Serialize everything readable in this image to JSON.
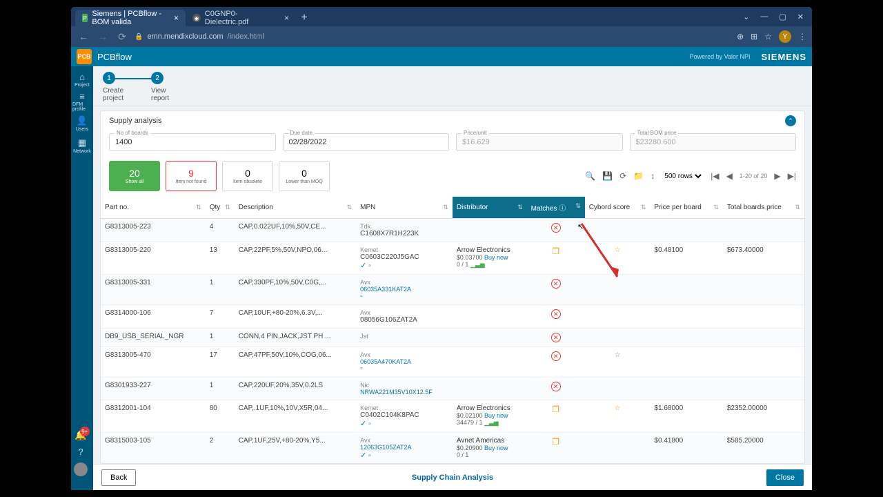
{
  "browser": {
    "tabs": [
      {
        "title": "Siemens | PCBflow - BOM valida",
        "active": true
      },
      {
        "title": "C0GNP0-Dielectric.pdf",
        "active": false
      }
    ],
    "url_host": "emn.mendixcloud.com",
    "url_path": "/index.html",
    "avatar_letter": "Y"
  },
  "app": {
    "title": "PCBflow",
    "powered_by": "Powered by Valor NPI",
    "brand": "SIEMENS",
    "rail": [
      {
        "icon": "⌂",
        "label": "Project"
      },
      {
        "icon": "≡",
        "label": "DFM profile"
      },
      {
        "icon": "👤",
        "label": "Users"
      },
      {
        "icon": "▦",
        "label": "Network"
      }
    ]
  },
  "stepper": {
    "s1_num": "1",
    "s1_l1": "Create",
    "s1_l2": "project",
    "s2_num": "2",
    "s2_l1": "View",
    "s2_l2": "report"
  },
  "panel": {
    "title": "Supply analysis",
    "no_boards_label": "No of boards",
    "no_boards": "1400",
    "due_date_label": "Due date",
    "due_date": "02/28/2022",
    "price_unit_label": "Price/unit",
    "price_unit": "$16.629",
    "total_bom_label": "Total BOM price",
    "total_bom": "$23280.600"
  },
  "cards": {
    "c1_num": "20",
    "c1_lbl": "Show all",
    "c2_num": "9",
    "c2_lbl": "Item not found",
    "c3_num": "0",
    "c3_lbl": "Item obsolete",
    "c4_num": "0",
    "c4_lbl": "Lower than MOQ"
  },
  "toolbar": {
    "rows": "500 rows",
    "page": "1-20 of 20"
  },
  "headers": {
    "partno": "Part no.",
    "qty": "Qty",
    "desc": "Description",
    "mpn": "MPN",
    "dist": "Distributor",
    "matches": "Matches",
    "cybord": "Cybord score",
    "ppb": "Price per board",
    "tbp": "Total boards price"
  },
  "rows": [
    {
      "partno": "G8313005-223",
      "qty": "4",
      "desc": "CAP,0.022UF,10%,50V,CE...",
      "mpn_mfr": "Tdk",
      "mpn_pn": "C1608X7R1H223K",
      "mpn_link": false,
      "chk": false,
      "dist": "",
      "match": "x",
      "star": "",
      "ppb": "",
      "tbp": ""
    },
    {
      "partno": "G8313005-220",
      "qty": "13",
      "desc": "CAP,22PF,5%,50V,NPO,06...",
      "mpn_mfr": "Kemet",
      "mpn_pn": "C0603C220J5GAC",
      "mpn_link": false,
      "chk": true,
      "dist": {
        "name": "Arrow Electronics",
        "price": "$0.03700",
        "buy": "Buy now",
        "qty": "0 / 1",
        "bars": true
      },
      "match": "stack",
      "star": "o",
      "ppb": "$0.48100",
      "tbp": "$673.40000"
    },
    {
      "partno": "G8313005-331",
      "qty": "1",
      "desc": "CAP,330PF,10%,50V,C0G,...",
      "mpn_mfr": "Avx",
      "mpn_pn": "06035A331KAT2A",
      "mpn_link": true,
      "chk": false,
      "box": true,
      "dist": "",
      "match": "x",
      "star": "",
      "ppb": "",
      "tbp": ""
    },
    {
      "partno": "G8314000-106",
      "qty": "7",
      "desc": "CAP,10UF,+80-20%,6.3V,...",
      "mpn_mfr": "Avx",
      "mpn_pn": "08056G106ZAT2A",
      "mpn_link": false,
      "chk": false,
      "dist": "",
      "match": "x",
      "star": "",
      "ppb": "",
      "tbp": ""
    },
    {
      "partno": "DB9_USB_SERIAL_NGR",
      "qty": "1",
      "desc": "CONN,4 PIN,JACK,JST PH ...",
      "mpn_mfr": "Jst",
      "mpn_pn": "",
      "mpn_link": false,
      "chk": false,
      "dist": "",
      "match": "x",
      "star": "",
      "ppb": "",
      "tbp": ""
    },
    {
      "partno": "G8313005-470",
      "qty": "17",
      "desc": "CAP,47PF,50V,10%,COG,06...",
      "mpn_mfr": "Avx",
      "mpn_pn": "06035A470KAT2A",
      "mpn_link": true,
      "chk": false,
      "box": true,
      "dist": "",
      "match": "x",
      "star": "g",
      "ppb": "",
      "tbp": ""
    },
    {
      "partno": "G8301933-227",
      "qty": "1",
      "desc": "CAP,220UF,20%,35V,0.2LS",
      "mpn_mfr": "Nic",
      "mpn_pn": "NRWA221M35V10X12.5F",
      "mpn_link": true,
      "chk": false,
      "dist": "",
      "match": "x",
      "star": "",
      "ppb": "",
      "tbp": ""
    },
    {
      "partno": "G8312001-104",
      "qty": "80",
      "desc": "CAP,.1UF,10%,10V,X5R,04...",
      "mpn_mfr": "Kemet",
      "mpn_pn": "C0402C104K8PAC",
      "mpn_link": false,
      "chk": true,
      "dist": {
        "name": "Arrow Electronics",
        "price": "$0.02100",
        "buy": "Buy now",
        "qty": "34479 / 1",
        "bars": true
      },
      "match": "stack",
      "star": "o",
      "ppb": "$1.68000",
      "tbp": "$2352.00000"
    },
    {
      "partno": "G8315003-105",
      "qty": "2",
      "desc": "CAP,1UF,25V,+80-20%,Y5...",
      "mpn_mfr": "Avx",
      "mpn_pn": "12063G105ZAT2A",
      "mpn_link": true,
      "chk": true,
      "dist": {
        "name": "Avnet Americas",
        "price": "$0.20900",
        "buy": "Buy now",
        "qty": "0 / 1",
        "bars": false
      },
      "match": "stack",
      "star": "",
      "ppb": "$0.41800",
      "tbp": "$585.20000"
    }
  ],
  "footer": {
    "back": "Back",
    "close": "Close",
    "mid": "Supply Chain Analysis"
  },
  "notif_count": "9+"
}
